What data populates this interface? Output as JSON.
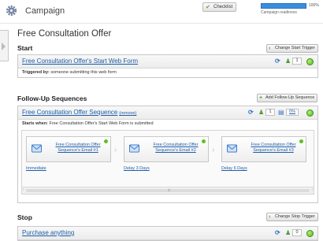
{
  "header": {
    "title": "Campaign",
    "checklist_label": "Checklist",
    "progress_percent": 100,
    "progress_label": "100%",
    "progress_caption": "Campaign readiness"
  },
  "page_title": "Free Consultation Offer",
  "start": {
    "title": "Start",
    "button_label": "Change Start Trigger",
    "item_label": "Free Consultation Offer's Start Web Form",
    "count": "1",
    "triggered_label": "Triggered by:",
    "triggered_text": "someone submitting this web form"
  },
  "followup": {
    "title": "Follow-Up Sequences",
    "button_label": "Add Follow-Up Sequence",
    "sequence_label": "Free Consultation Offer Sequence",
    "remove_label": "(remove)",
    "count": "1",
    "percent": "0%",
    "starts_label": "Starts when:",
    "starts_text": "Free Consultation Offer's Start Web Form is submitted",
    "emails": [
      {
        "label": "Free Consultation Offer Sequence's Email #1",
        "delay": "Immediate"
      },
      {
        "label": "Free Consultation Offer Sequence's Email #2",
        "delay": "Delay 3 Days"
      },
      {
        "label": "Free Consultation Offer Sequence's Email #3",
        "delay": "Delay 6 Days"
      }
    ]
  },
  "stop": {
    "title": "Stop",
    "button_label": "Change Stop Trigger",
    "item_label": "Purchase anything",
    "count": "0"
  },
  "colors": {
    "link": "#1e5ea8",
    "progress": "#3a8ede",
    "status_green": "#4fb51e"
  }
}
